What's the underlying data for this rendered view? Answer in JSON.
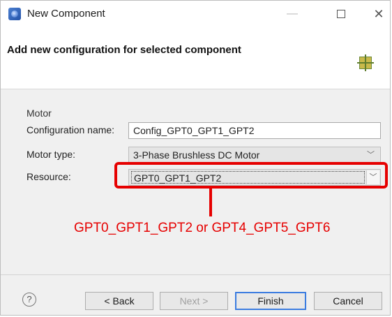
{
  "window": {
    "title": "New Component"
  },
  "banner": {
    "title": "Add new configuration for selected component"
  },
  "group": {
    "label": "Motor",
    "fields": {
      "config_name_label": "Configuration name:",
      "config_name_value": "Config_GPT0_GPT1_GPT2",
      "motor_type_label": "Motor type:",
      "motor_type_value": "3-Phase Brushless DC Motor",
      "resource_label": "Resource:",
      "resource_value": "GPT0_GPT1_GPT2"
    }
  },
  "annotation": {
    "text": "GPT0_GPT1_GPT2 or GPT4_GPT5_GPT6",
    "color": "#e60000"
  },
  "buttons": {
    "help": "?",
    "back": "< Back",
    "next": "Next >",
    "finish": "Finish",
    "cancel": "Cancel"
  },
  "colors": {
    "accent": "#3b7ce0",
    "highlight": "#e60000"
  }
}
